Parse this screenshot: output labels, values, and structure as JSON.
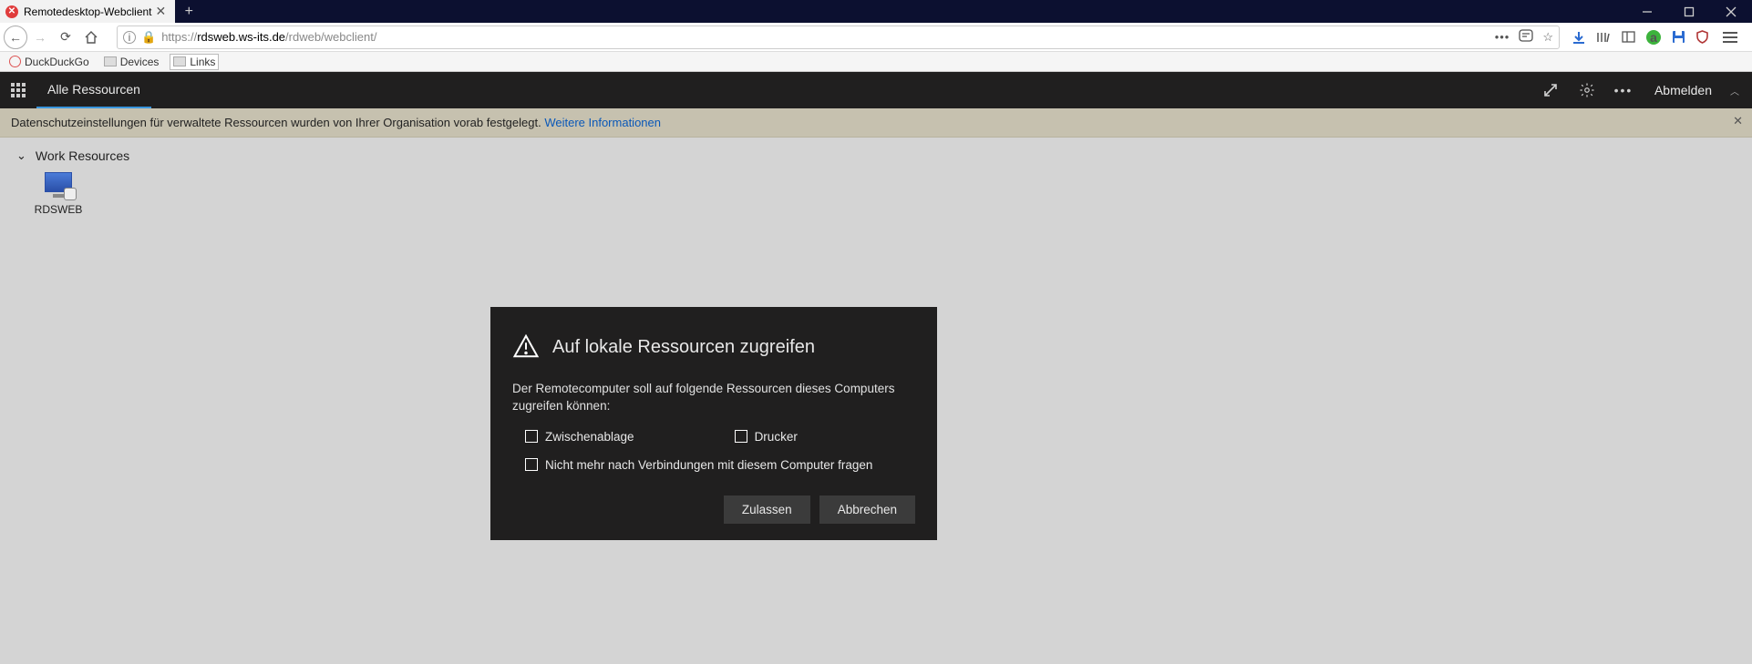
{
  "browser": {
    "tab_title": "Remotedesktop-Webclient",
    "url_protocol": "https://",
    "url_host": "rdsweb.ws-its.de",
    "url_path": "/rdweb/webclient/",
    "bookmarks": [
      {
        "label": "DuckDuckGo"
      },
      {
        "label": "Devices"
      },
      {
        "label": "Links"
      }
    ]
  },
  "appheader": {
    "title": "Alle Ressourcen",
    "signout": "Abmelden"
  },
  "notice": {
    "text": "Datenschutzeinstellungen für verwaltete Ressourcen wurden von Ihrer Organisation vorab festgelegt. ",
    "link": "Weitere Informationen"
  },
  "group": {
    "name": "Work Resources",
    "resources": [
      {
        "label": "RDSWEB"
      }
    ]
  },
  "dialog": {
    "title": "Auf lokale Ressourcen zugreifen",
    "message": "Der Remotecomputer soll auf folgende Ressourcen dieses Computers zugreifen können:",
    "opt_clipboard": "Zwischenablage",
    "opt_printer": "Drucker",
    "opt_remember": "Nicht mehr nach Verbindungen mit diesem Computer fragen",
    "btn_allow": "Zulassen",
    "btn_cancel": "Abbrechen"
  }
}
